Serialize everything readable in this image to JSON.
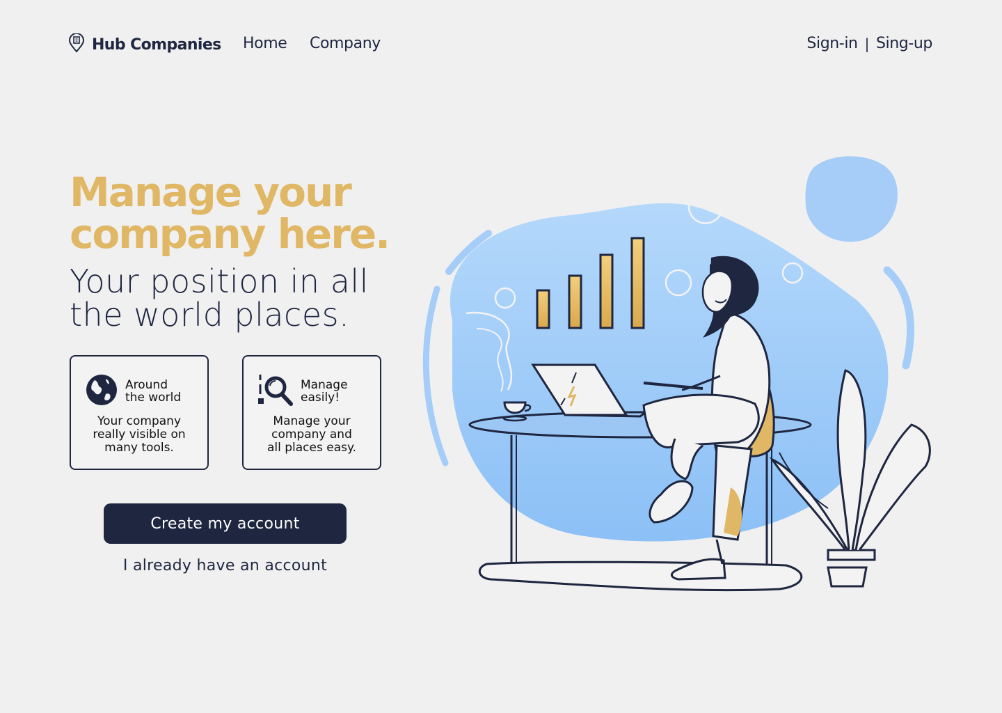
{
  "nav": {
    "brand": "Hub Companies",
    "links": [
      "Home",
      "Company"
    ],
    "sign_in": "Sign-in",
    "separator": "|",
    "sign_up": "Sing-up"
  },
  "hero": {
    "headline": [
      "Manage your",
      "company here."
    ],
    "subheadline": [
      "Your position in all",
      "the world places."
    ]
  },
  "features": [
    {
      "icon": "globe-icon",
      "title": [
        "Around",
        "the world"
      ],
      "body": [
        "Your company",
        "really visible on",
        "many tools."
      ]
    },
    {
      "icon": "magnifier-icon",
      "title": [
        "Manage",
        "easily!"
      ],
      "body": [
        "Manage your",
        "company and",
        "all places easy."
      ]
    }
  ],
  "cta": {
    "primary": "Create my account",
    "secondary": "I already have an account"
  },
  "colors": {
    "background": "#f0f0f0",
    "navy": "#1e2640",
    "gold": "#e0b765",
    "blob_blue": "#a8d0fa"
  }
}
